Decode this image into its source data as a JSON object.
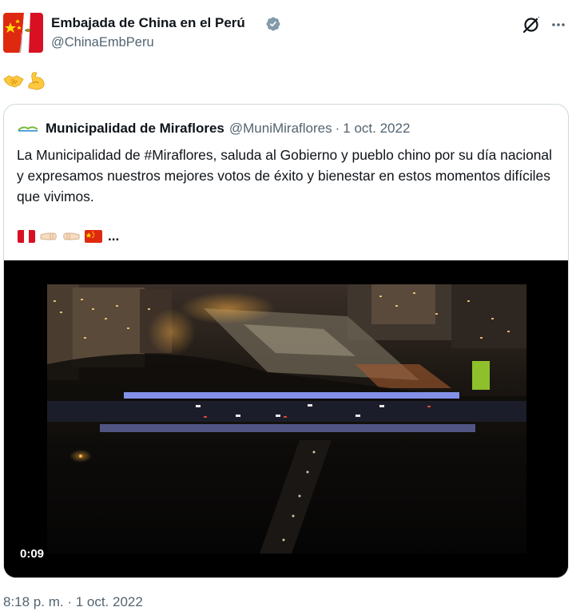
{
  "tweet": {
    "author": {
      "name": "Embajada de China en el Perú",
      "handle": "@ChinaEmbPeru",
      "verified": true,
      "avatar_icon": "china-peru-flags-avatar"
    },
    "body_emojis": [
      "handshake-emoji",
      "flexed-biceps-emoji"
    ],
    "timestamp": "8:18 p. m. · 1 oct. 2022",
    "quoted": {
      "name": "Municipalidad de Miraflores",
      "handle": "@MuniMiraflores",
      "separator": "·",
      "date": "1 oct. 2022",
      "text": "La Municipalidad de #Miraflores, saluda al Gobierno y pueblo chino por su día nacional y expresamos nuestros mejores votos de éxito y bienestar en estos momentos difíciles que vivimos.",
      "trailing_emojis": [
        "peru-flag-emoji",
        "fist-bump-left-emoji",
        "fist-bump-right-emoji",
        "china-flag-emoji"
      ],
      "ellipsis": "...",
      "video": {
        "duration": "0:09",
        "description_icon": "night-aerial-city-video"
      }
    }
  },
  "colors": {
    "text_primary": "#0f1419",
    "text_secondary": "#536471",
    "border": "#cfd9de",
    "verified_badge": "#829aab",
    "china_red": "#de2910",
    "peru_red": "#d91023"
  }
}
